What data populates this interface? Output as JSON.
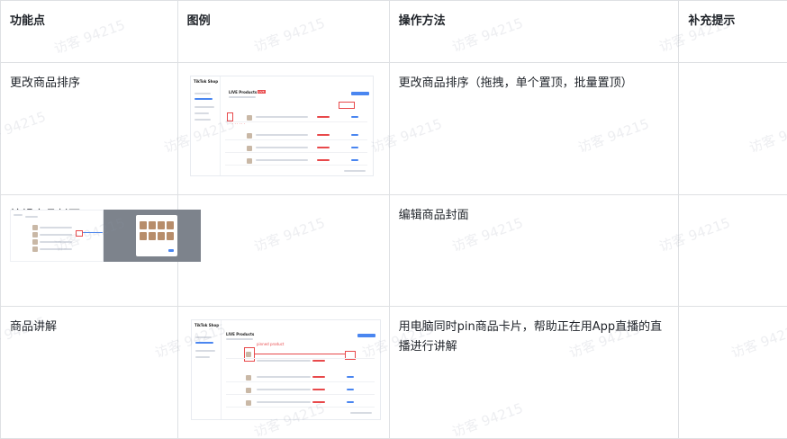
{
  "table": {
    "headers": [
      "功能点",
      "图例",
      "操作方法",
      "补充提示"
    ],
    "rows": [
      {
        "feature": "更改商品排序",
        "method": "更改商品排序（拖拽，单个置顶，批量置顶）",
        "tip": ""
      },
      {
        "feature": "编辑商品封面",
        "method": "编辑商品封面",
        "tip": ""
      },
      {
        "feature": "商品讲解",
        "method": "用电脑同时pin商品卡片，帮助正在用App直播的直播进行讲解",
        "tip": ""
      }
    ]
  },
  "thumbnails": {
    "sort": {
      "logo": "TikTok Shop",
      "title": "LIVE Products",
      "badge": "LIVE"
    },
    "pin": {
      "logo": "TikTok Shop",
      "title": "LIVE Products",
      "note": "pinned product"
    }
  },
  "watermark": {
    "text": "访客 94215"
  },
  "colors": {
    "border": "#dee0e3",
    "accent_red": "#e8494b",
    "accent_blue": "#4a86f0"
  }
}
